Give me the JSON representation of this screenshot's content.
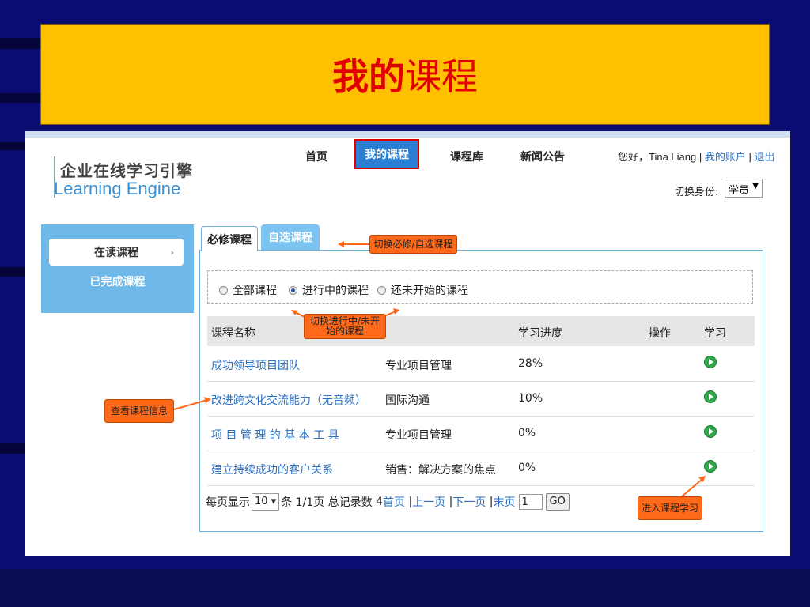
{
  "slide": {
    "title_bold": "我的",
    "title_rest": "课程"
  },
  "logo": {
    "cn": "企业在线学习引擎",
    "en": "Learning Engine"
  },
  "nav": {
    "home": "首页",
    "my_courses": "我的课程",
    "library": "课程库",
    "news": "新闻公告"
  },
  "user": {
    "greeting": "您好，Tina Liang",
    "sep1": " | ",
    "account": "我的账户",
    "sep2": " | ",
    "logout": "退出",
    "switch_label": "切换身份:",
    "role": "学员"
  },
  "sidebar": {
    "reading": "在读课程",
    "completed": "已完成课程"
  },
  "tabs": {
    "required": "必修课程",
    "elective": "自选课程"
  },
  "filters": {
    "all": "全部课程",
    "in_progress": "进行中的课程",
    "not_started": "还未开始的课程"
  },
  "table": {
    "headers": {
      "name": "课程名称",
      "progress": "学习进度",
      "action": "操作",
      "study": "学习"
    },
    "rows": [
      {
        "name": "成功领导项目团队",
        "category": "专业项目管理",
        "progress": "28%"
      },
      {
        "name": "改进跨文化交流能力（无音频）",
        "category": "国际沟通",
        "progress": "10%"
      },
      {
        "name": "项 目 管 理 的 基 本 工 具",
        "category": "专业项目管理",
        "progress": "0%"
      },
      {
        "name": "建立持续成功的客户关系",
        "category": "销售：解决方案的焦点",
        "progress": "0%"
      }
    ]
  },
  "pager": {
    "per_page_label": "每页显示",
    "per_page_value": "10 ▾",
    "suffix": "条",
    "page_info": "1/1页",
    "total_label": "总记录数",
    "total": "4",
    "first": "首页",
    "prev": "上一页",
    "next": "下一页",
    "last": "末页",
    "page_input": "1",
    "go": "GO"
  },
  "callouts": {
    "switch_tab": "切换必修/自选课程",
    "switch_status": "切换进行中/未开始的课程",
    "view_info": "查看课程信息",
    "enter_study": "进入课程学习"
  },
  "colors": {
    "background": "#0b0b72",
    "title_bg": "#ffc000",
    "title_text": "#e00000",
    "accent": "#2a7fd4",
    "callout": "#ff6a1a"
  }
}
